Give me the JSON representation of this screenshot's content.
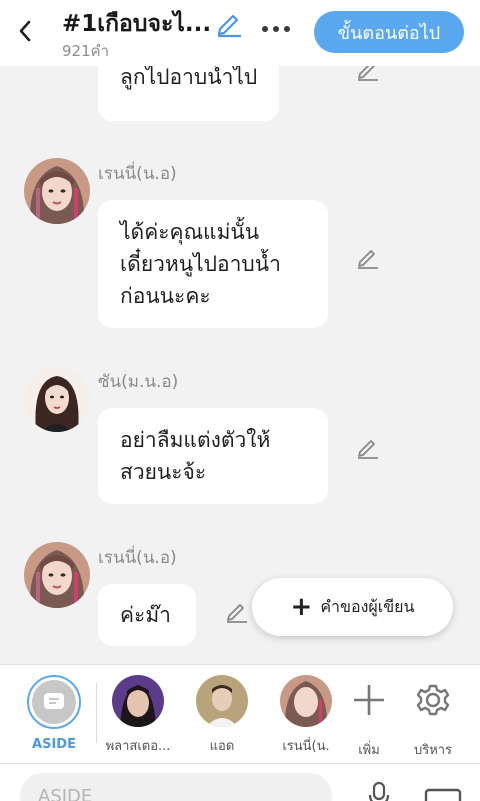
{
  "header": {
    "title": "#1เกือบจะไ...",
    "word_count": "921คำ",
    "next_label": "ขั้นตอนต่อไป"
  },
  "messages": [
    {
      "sender": "",
      "lines": [
        "ลูกไปอาบน้ำไป"
      ]
    },
    {
      "sender": "เรนนี่(น.อ)",
      "lines": [
        "ได้ค่ะคุณแม่นั้น",
        "เดี๋ยวหนูไปอาบน้ำ",
        "ก่อนนะคะ"
      ]
    },
    {
      "sender": "ซัน(ม.น.อ)",
      "lines": [
        "อย่าลืมแต่งตัวให้",
        "สวยนะจ้ะ"
      ]
    },
    {
      "sender": "เรนนี่(น.อ)",
      "lines": [
        "ค่ะม๊า"
      ]
    }
  ],
  "fab": {
    "label": "คำของผู้เขียน"
  },
  "characters": {
    "aside": "ASIDE",
    "c1": "พลาสเตอ...",
    "c2": "แอด",
    "c3": "เรนนี่(น.",
    "add": "เพิ่ม",
    "manage": "บริหาร"
  },
  "input": {
    "placeholder": "ASIDE"
  },
  "colors": {
    "accent": "#5aa9f0",
    "aside_label": "#4a98e6"
  }
}
